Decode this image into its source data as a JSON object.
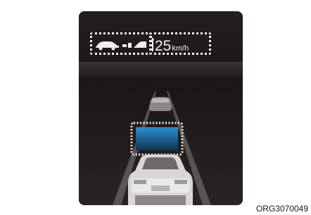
{
  "cluster": {
    "speed_value": "25",
    "speed_unit": "km/h",
    "set_speed_icon": "set-speed-indicator-icon",
    "distance_icon": "vehicle-distance-icon"
  },
  "caption": "ORG3070049",
  "colors": {
    "background": "#1c1718",
    "highlight": "#f2f2f2",
    "screen_accent": "#2a8fd0"
  }
}
